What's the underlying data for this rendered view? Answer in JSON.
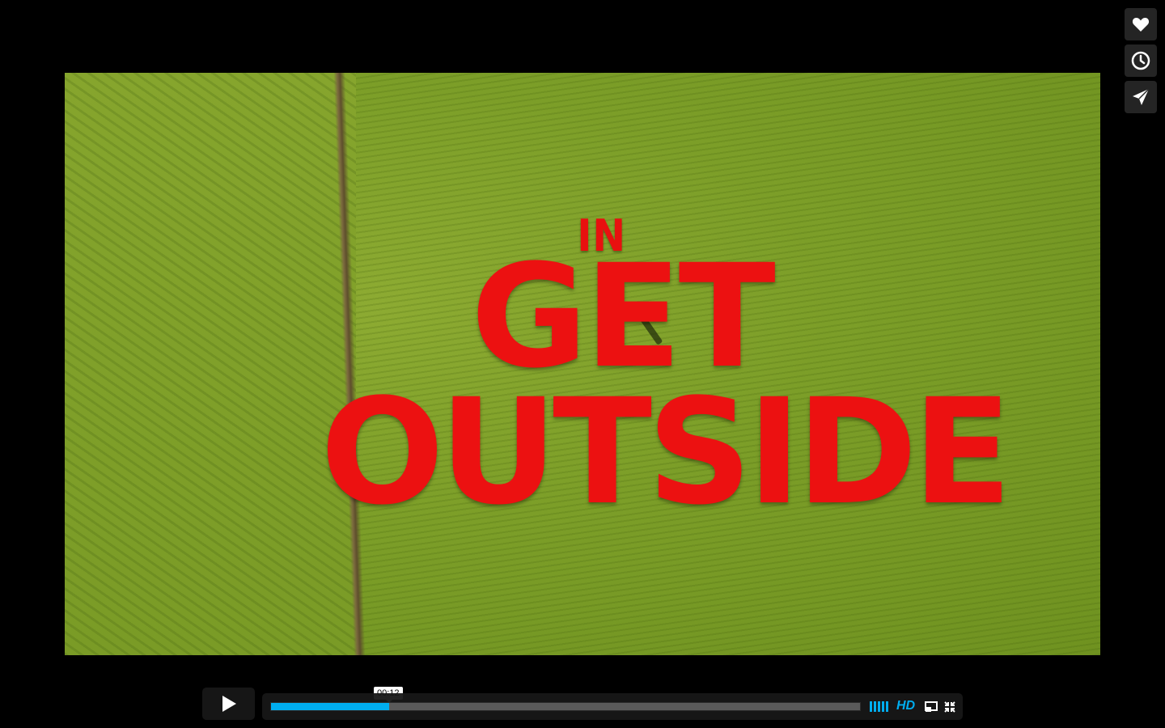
{
  "video": {
    "title_lines": [
      "IN",
      "GET",
      "OUTSIDE"
    ]
  },
  "side_actions": [
    {
      "name": "like",
      "icon": "heart-icon"
    },
    {
      "name": "watch-later",
      "icon": "clock-icon"
    },
    {
      "name": "share",
      "icon": "send-icon"
    }
  ],
  "controls": {
    "play_icon": "play-icon",
    "timecode": "00:12",
    "progress_fraction": 0.2,
    "hd_label": "HD",
    "accent_color": "#00adef",
    "icons": {
      "volume": "volume-bars-icon",
      "pip": "picture-in-picture-icon",
      "fullscreen": "fullscreen-icon"
    }
  }
}
